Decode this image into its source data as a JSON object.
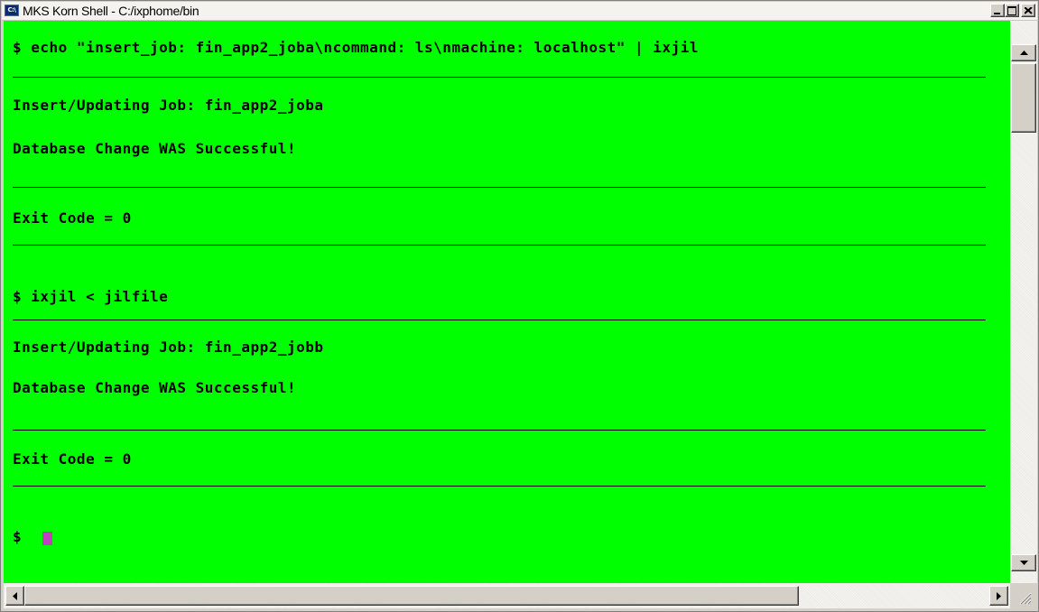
{
  "window": {
    "title": "MKS Korn Shell - C:/ixphome/bin",
    "icon_label": "C:\\",
    "icon": "console-icon"
  },
  "title_buttons": {
    "minimize": "minimize-icon",
    "maximize": "maximize-icon",
    "close": "close-icon"
  },
  "terminal": {
    "background": "#00ff00",
    "foreground": "#000000",
    "cursor_color": "#c040c0",
    "lines": [
      "$ echo \"insert_job: fin_app2_joba\\ncommand: ls\\nmachine: localhost\" | ixjil",
      "Insert/Updating Job: fin_app2_joba",
      "Database Change WAS Successful!",
      "Exit Code = 0",
      "$ ixjil < jilfile",
      "Insert/Updating Job: fin_app2_jobb",
      "Database Change WAS Successful!",
      "Exit Code = 0",
      "$ "
    ]
  },
  "scrollbars": {
    "vertical": {
      "up": "scroll-up-arrow-icon",
      "down": "scroll-down-arrow-icon"
    },
    "horizontal": {
      "left": "scroll-left-arrow-icon",
      "right": "scroll-right-arrow-icon"
    }
  }
}
